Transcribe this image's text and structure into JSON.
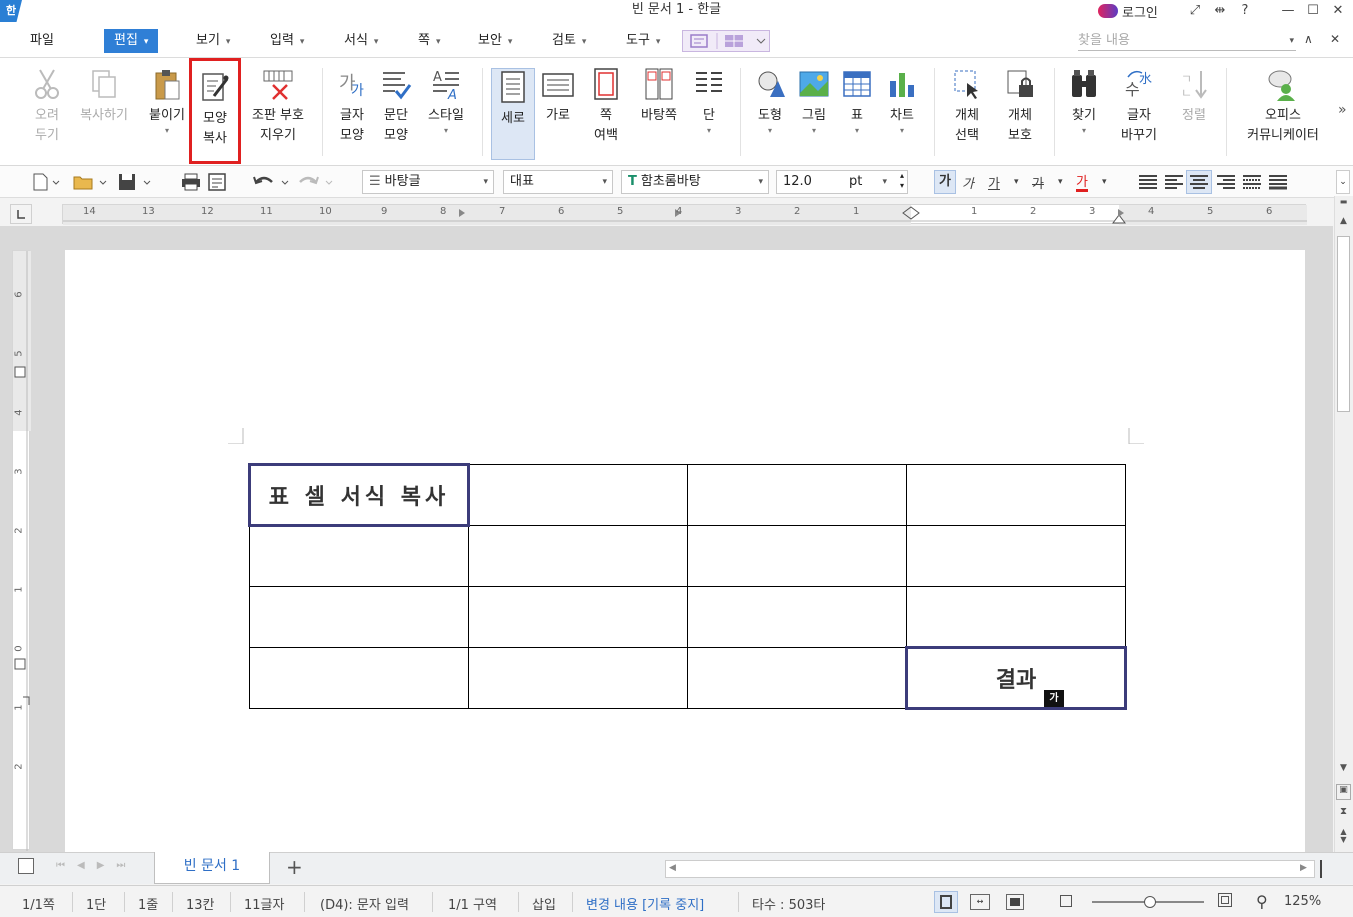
{
  "app": {
    "logo_text": "한",
    "title": "빈 문서 1 - 한글",
    "login_label": "로그인"
  },
  "window": {
    "buttons": [
      "⤢",
      "⇹",
      "?",
      "—",
      "☐",
      "✕"
    ]
  },
  "menu": {
    "items": [
      {
        "label": "파일",
        "arrow": ""
      },
      {
        "label": "편집",
        "arrow": "▾"
      },
      {
        "label": "보기",
        "arrow": "▾"
      },
      {
        "label": "입력",
        "arrow": "▾"
      },
      {
        "label": "서식",
        "arrow": "▾"
      },
      {
        "label": "쪽",
        "arrow": "▾"
      },
      {
        "label": "보안",
        "arrow": "▾"
      },
      {
        "label": "검토",
        "arrow": "▾"
      },
      {
        "label": "도구",
        "arrow": "▾"
      }
    ],
    "search_placeholder": "찾을 내용",
    "search_dd": "▾",
    "collapse": "∧",
    "close": "✕"
  },
  "ribbon": {
    "cut": "오려\n두기",
    "copy": "복사하기",
    "paste": "붙이기",
    "paste_format": "모양\n복사",
    "clear_marks": "조판 부호\n지우기",
    "char_shape": "글자\n모양",
    "para_shape": "문단\n모양",
    "style": "스타일",
    "vertical": "세로",
    "horizontal": "가로",
    "margin": "쪽\n여백",
    "background": "바탕쪽",
    "columns": "단",
    "shape": "도형",
    "picture": "그림",
    "table": "표",
    "chart": "차트",
    "select_obj": "개체\n선택",
    "protect_obj": "개체\n보호",
    "find": "찾기",
    "replace": "글자\n바꾸기",
    "sort": "정렬",
    "office_community": "오피스\n커뮤니케이터",
    "more": "»"
  },
  "toolbar": {
    "style_name": "바탕글",
    "para_style": "대표",
    "font": "함초롬바탕",
    "size": "12.0",
    "unit": "pt",
    "bold": "가",
    "italic": "가",
    "underline": "가",
    "strike": "가",
    "color": "가"
  },
  "ruler": {
    "h_ticks": [
      "14",
      "13",
      "12",
      "11",
      "10",
      "9",
      "8",
      "7",
      "6",
      "5",
      "4",
      "3",
      "2",
      "1",
      "1",
      "2",
      "3",
      "4",
      "5",
      "6"
    ],
    "v_ticks": [
      "6",
      "5",
      "4",
      "3",
      "2",
      "1",
      "0",
      "1",
      "2"
    ]
  },
  "document": {
    "table": [
      [
        "표 셀 서식 복사",
        "",
        "",
        ""
      ],
      [
        "",
        "",
        "",
        ""
      ],
      [
        "",
        "",
        "",
        ""
      ],
      [
        "",
        "",
        "",
        "결과"
      ]
    ],
    "cursor_badge": "가"
  },
  "tabs": {
    "doc_tab": "빈 문서 1",
    "add": "+"
  },
  "status": {
    "page": "1/1쪽",
    "column": "1단",
    "line": "1줄",
    "col": "13칸",
    "chars": "11글자",
    "mode": "(D4): 문자 입력",
    "section": "1/1 구역",
    "insert": "삽입",
    "track": "변경 내용 [기록 중지]",
    "strokes": "타수 : 503타",
    "zoom": "125%"
  }
}
